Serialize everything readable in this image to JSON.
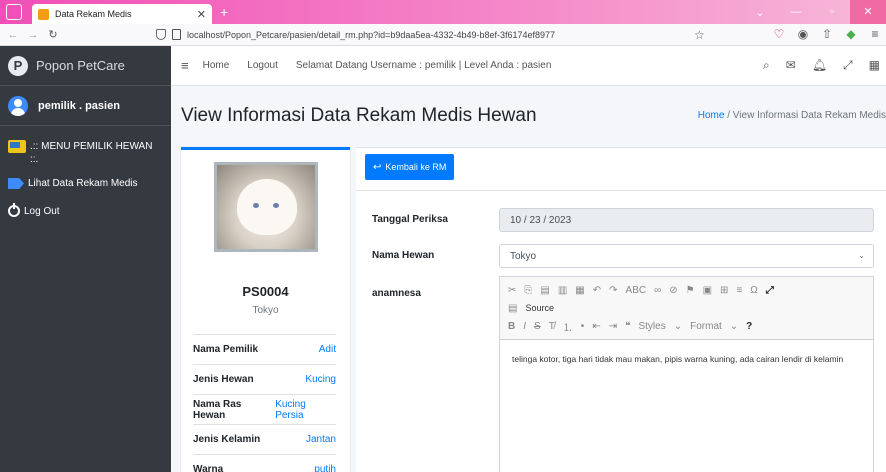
{
  "browser": {
    "tab_title": "Data Rekam Medis",
    "url": "localhost/Popon_Petcare/pasien/detail_rm.php?id=b9daa5ea-4332-4b49-b8ef-3f6174ef8977"
  },
  "sidebar": {
    "brand": "Popon PetCare",
    "user": "pemilik . pasien",
    "menu_header": ".:: MENU PEMILIK HEWAN ::.",
    "items": [
      {
        "label": "Lihat Data Rekam Medis"
      },
      {
        "label": "Log Out"
      }
    ]
  },
  "topnav": {
    "home": "Home",
    "logout": "Logout",
    "welcome": "Selamat Datang Username : pemilik | Level Anda : pasien",
    "msg_badge": "",
    "notif_badge": ""
  },
  "header": {
    "title": "View Informasi Data Rekam Medis Hewan",
    "breadcrumb_home": "Home",
    "breadcrumb_sep": "/",
    "breadcrumb_current": "View Informasi Data Rekam Medis"
  },
  "profile": {
    "code": "PS0004",
    "name": "Tokyo",
    "rows": [
      {
        "label": "Nama Pemilik",
        "value": "Adit"
      },
      {
        "label": "Jenis Hewan",
        "value": "Kucing"
      },
      {
        "label": "Nama Ras Hewan",
        "value": "Kucing Persia"
      },
      {
        "label": "Jenis Kelamin",
        "value": "Jantan"
      },
      {
        "label": "Warna",
        "value": "putih"
      }
    ]
  },
  "form": {
    "back_button": "Kembali ke RM",
    "tanggal_label": "Tanggal Periksa",
    "tanggal_value": "10 / 23 / 2023",
    "hewan_label": "Nama Hewan",
    "hewan_value": "Tokyo",
    "anamnesa_label": "anamnesa",
    "source_label": "Source",
    "styles_label": "Styles",
    "format_label": "Format",
    "anamnesa_text": "telinga kotor, tiga hari tidak mau makan, pipis warna kuning, ada cairan lendir di kelamin"
  }
}
